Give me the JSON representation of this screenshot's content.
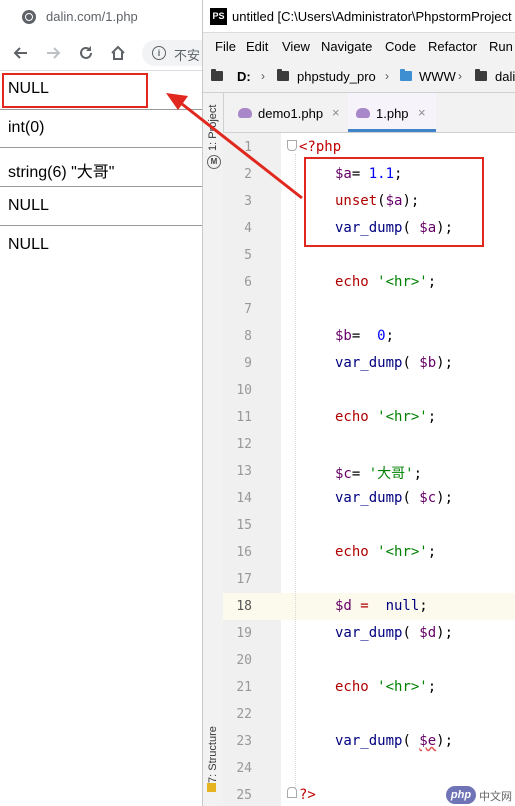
{
  "browser": {
    "tab_title": "dalin.com/1.php",
    "omnibox_security_text": "不安",
    "output": [
      "NULL",
      "int(0)",
      "string(6) \"大哥\"",
      "NULL",
      "NULL"
    ]
  },
  "ide": {
    "title": "untitled [C:\\Users\\Administrator\\PhpstormProject",
    "logo": "PS",
    "menu": [
      "File",
      "Edit",
      "View",
      "Navigate",
      "Code",
      "Refactor",
      "Run"
    ],
    "breadcrumb": [
      "D:",
      "phpstudy_pro",
      "WWW",
      "dali"
    ],
    "side_panels": {
      "project": "1: Project",
      "structure": "7: Structure"
    },
    "tabs": [
      {
        "label": "demo1.php",
        "active": false
      },
      {
        "label": "1.php",
        "active": true
      }
    ],
    "current_line": 18,
    "line_numbers": [
      "1",
      "2",
      "3",
      "4",
      "5",
      "6",
      "7",
      "8",
      "9",
      "10",
      "11",
      "12",
      "13",
      "14",
      "15",
      "16",
      "17",
      "18",
      "19",
      "20",
      "21",
      "22",
      "23",
      "24",
      "25"
    ],
    "code": {
      "l1": "<?php",
      "l2_var": "$a",
      "l2_op": "= ",
      "l2_num": "1.1",
      "l2_end": ";",
      "l3_fn": "unset",
      "l3_open": "(",
      "l3_var": "$a",
      "l3_end": ");",
      "l4_fn": "var_dump",
      "l4_open": "( ",
      "l4_var": "$a",
      "l4_end": ");",
      "l6_echo": "echo",
      "l6_str": "'<hr>'",
      "l6_end": ";",
      "l8_var": "$b",
      "l8_op": "=  ",
      "l8_num": "0",
      "l8_end": ";",
      "l9_fn": "var_dump",
      "l9_open": "( ",
      "l9_var": "$b",
      "l9_end": ");",
      "l11_echo": "echo",
      "l11_str": "'<hr>'",
      "l11_end": ";",
      "l13_var": "$c",
      "l13_op": "= ",
      "l13_str": "'大哥'",
      "l13_end": ";",
      "l14_fn": "var_dump",
      "l14_open": "( ",
      "l14_var": "$c",
      "l14_end": ");",
      "l16_echo": "echo",
      "l16_str": "'<hr>'",
      "l16_end": ";",
      "l18_var": "$d",
      "l18_op": " =  ",
      "l18_kw": "null",
      "l18_end": ";",
      "l19_fn": "var_dump",
      "l19_open": "( ",
      "l19_var": "$d",
      "l19_end": ");",
      "l21_echo": "echo",
      "l21_str": "'<hr>'",
      "l21_end": ";",
      "l23_fn": "var_dump",
      "l23_open": "( ",
      "l23_var": "$e",
      "l23_end": ");",
      "l25": "?>"
    }
  },
  "watermark": {
    "logo": "php",
    "text": "中文网"
  },
  "colors": {
    "annotation": "#e0281e",
    "tab_underline": "#4083c9",
    "php_keyword": "#000080",
    "php_variable": "#660066",
    "php_string": "#008000",
    "php_echo": "#b00000"
  }
}
